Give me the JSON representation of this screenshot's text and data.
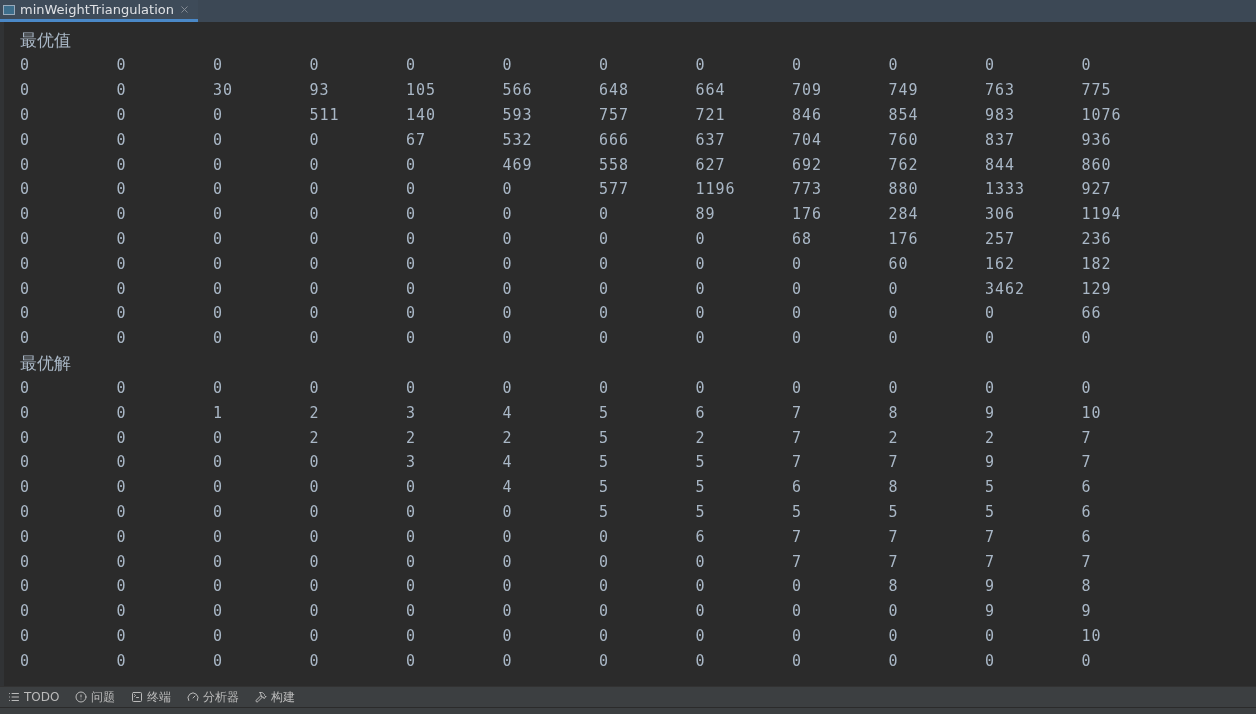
{
  "tab": {
    "title": "minWeightTriangulation",
    "selected": true
  },
  "sections": [
    {
      "title": "最优值",
      "rows": [
        [
          "0",
          "0",
          "0",
          "0",
          "0",
          "0",
          "0",
          "0",
          "0",
          "0",
          "0",
          "0"
        ],
        [
          "0",
          "0",
          "30",
          "93",
          "105",
          "566",
          "648",
          "664",
          "709",
          "749",
          "763",
          "775"
        ],
        [
          "0",
          "0",
          "0",
          "511",
          "140",
          "593",
          "757",
          "721",
          "846",
          "854",
          "983",
          "1076"
        ],
        [
          "0",
          "0",
          "0",
          "0",
          "67",
          "532",
          "666",
          "637",
          "704",
          "760",
          "837",
          "936"
        ],
        [
          "0",
          "0",
          "0",
          "0",
          "0",
          "469",
          "558",
          "627",
          "692",
          "762",
          "844",
          "860"
        ],
        [
          "0",
          "0",
          "0",
          "0",
          "0",
          "0",
          "577",
          "1196",
          "773",
          "880",
          "1333",
          "927"
        ],
        [
          "0",
          "0",
          "0",
          "0",
          "0",
          "0",
          "0",
          "89",
          "176",
          "284",
          "306",
          "1194"
        ],
        [
          "0",
          "0",
          "0",
          "0",
          "0",
          "0",
          "0",
          "0",
          "68",
          "176",
          "257",
          "236"
        ],
        [
          "0",
          "0",
          "0",
          "0",
          "0",
          "0",
          "0",
          "0",
          "0",
          "60",
          "162",
          "182"
        ],
        [
          "0",
          "0",
          "0",
          "0",
          "0",
          "0",
          "0",
          "0",
          "0",
          "0",
          "3462",
          "129"
        ],
        [
          "0",
          "0",
          "0",
          "0",
          "0",
          "0",
          "0",
          "0",
          "0",
          "0",
          "0",
          "66"
        ],
        [
          "0",
          "0",
          "0",
          "0",
          "0",
          "0",
          "0",
          "0",
          "0",
          "0",
          "0",
          "0"
        ]
      ]
    },
    {
      "title": "最优解",
      "rows": [
        [
          "0",
          "0",
          "0",
          "0",
          "0",
          "0",
          "0",
          "0",
          "0",
          "0",
          "0",
          "0"
        ],
        [
          "0",
          "0",
          "1",
          "2",
          "3",
          "4",
          "5",
          "6",
          "7",
          "8",
          "9",
          "10"
        ],
        [
          "0",
          "0",
          "0",
          "2",
          "2",
          "2",
          "5",
          "2",
          "7",
          "2",
          "2",
          "7"
        ],
        [
          "0",
          "0",
          "0",
          "0",
          "3",
          "4",
          "5",
          "5",
          "7",
          "7",
          "9",
          "7"
        ],
        [
          "0",
          "0",
          "0",
          "0",
          "0",
          "4",
          "5",
          "5",
          "6",
          "8",
          "5",
          "6"
        ],
        [
          "0",
          "0",
          "0",
          "0",
          "0",
          "0",
          "5",
          "5",
          "5",
          "5",
          "5",
          "6"
        ],
        [
          "0",
          "0",
          "0",
          "0",
          "0",
          "0",
          "0",
          "6",
          "7",
          "7",
          "7",
          "6"
        ],
        [
          "0",
          "0",
          "0",
          "0",
          "0",
          "0",
          "0",
          "0",
          "7",
          "7",
          "7",
          "7"
        ],
        [
          "0",
          "0",
          "0",
          "0",
          "0",
          "0",
          "0",
          "0",
          "0",
          "8",
          "9",
          "8"
        ],
        [
          "0",
          "0",
          "0",
          "0",
          "0",
          "0",
          "0",
          "0",
          "0",
          "0",
          "9",
          "9"
        ],
        [
          "0",
          "0",
          "0",
          "0",
          "0",
          "0",
          "0",
          "0",
          "0",
          "0",
          "0",
          "10"
        ],
        [
          "0",
          "0",
          "0",
          "0",
          "0",
          "0",
          "0",
          "0",
          "0",
          "0",
          "0",
          "0"
        ]
      ]
    }
  ],
  "toolbar": [
    {
      "kind": "list",
      "label": "TODO"
    },
    {
      "kind": "problems",
      "label": "问题"
    },
    {
      "kind": "terminal",
      "label": "终端"
    },
    {
      "kind": "profiler",
      "label": "分析器"
    },
    {
      "kind": "build",
      "label": "构建"
    }
  ]
}
